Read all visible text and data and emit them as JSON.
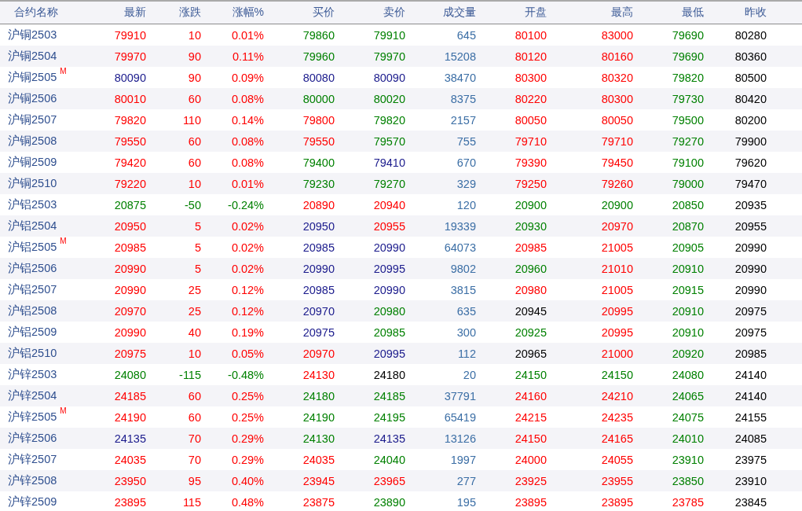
{
  "table": {
    "columns": [
      "合约名称",
      "最新",
      "涨跌",
      "涨幅%",
      "买价",
      "卖价",
      "成交量",
      "开盘",
      "最高",
      "最低",
      "昨收"
    ],
    "rows": [
      {
        "cells": [
          {
            "text": "沪铜2503"
          },
          {
            "text": "79910",
            "color": "#ff0000"
          },
          {
            "text": "10",
            "color": "#ff0000"
          },
          {
            "text": "0.01%",
            "color": "#ff0000"
          },
          {
            "text": "79860",
            "color": "#008000"
          },
          {
            "text": "79910",
            "color": "#008000"
          },
          {
            "text": "645",
            "color": "#3b6ea5"
          },
          {
            "text": "80100",
            "color": "#ff0000"
          },
          {
            "text": "83000",
            "color": "#ff0000"
          },
          {
            "text": "79690",
            "color": "#008000"
          },
          {
            "text": "80280",
            "color": "#000000"
          }
        ]
      },
      {
        "cells": [
          {
            "text": "沪铜2504"
          },
          {
            "text": "79970",
            "color": "#ff0000"
          },
          {
            "text": "90",
            "color": "#ff0000"
          },
          {
            "text": "0.11%",
            "color": "#ff0000"
          },
          {
            "text": "79960",
            "color": "#008000"
          },
          {
            "text": "79970",
            "color": "#008000"
          },
          {
            "text": "15208",
            "color": "#3b6ea5"
          },
          {
            "text": "80120",
            "color": "#ff0000"
          },
          {
            "text": "80160",
            "color": "#ff0000"
          },
          {
            "text": "79690",
            "color": "#008000"
          },
          {
            "text": "80360",
            "color": "#000000"
          }
        ]
      },
      {
        "cells": [
          {
            "text": "沪铜2505",
            "badge": "M"
          },
          {
            "text": "80090",
            "color": "#1a1a8c"
          },
          {
            "text": "90",
            "color": "#ff0000"
          },
          {
            "text": "0.09%",
            "color": "#ff0000"
          },
          {
            "text": "80080",
            "color": "#1a1a8c"
          },
          {
            "text": "80090",
            "color": "#1a1a8c"
          },
          {
            "text": "38470",
            "color": "#3b6ea5"
          },
          {
            "text": "80300",
            "color": "#ff0000"
          },
          {
            "text": "80320",
            "color": "#ff0000"
          },
          {
            "text": "79820",
            "color": "#008000"
          },
          {
            "text": "80500",
            "color": "#000000"
          }
        ]
      },
      {
        "cells": [
          {
            "text": "沪铜2506"
          },
          {
            "text": "80010",
            "color": "#ff0000"
          },
          {
            "text": "60",
            "color": "#ff0000"
          },
          {
            "text": "0.08%",
            "color": "#ff0000"
          },
          {
            "text": "80000",
            "color": "#008000"
          },
          {
            "text": "80020",
            "color": "#008000"
          },
          {
            "text": "8375",
            "color": "#3b6ea5"
          },
          {
            "text": "80220",
            "color": "#ff0000"
          },
          {
            "text": "80300",
            "color": "#ff0000"
          },
          {
            "text": "79730",
            "color": "#008000"
          },
          {
            "text": "80420",
            "color": "#000000"
          }
        ]
      },
      {
        "cells": [
          {
            "text": "沪铜2507"
          },
          {
            "text": "79820",
            "color": "#ff0000"
          },
          {
            "text": "110",
            "color": "#ff0000"
          },
          {
            "text": "0.14%",
            "color": "#ff0000"
          },
          {
            "text": "79800",
            "color": "#ff0000"
          },
          {
            "text": "79820",
            "color": "#008000"
          },
          {
            "text": "2157",
            "color": "#3b6ea5"
          },
          {
            "text": "80050",
            "color": "#ff0000"
          },
          {
            "text": "80050",
            "color": "#ff0000"
          },
          {
            "text": "79500",
            "color": "#008000"
          },
          {
            "text": "80200",
            "color": "#000000"
          }
        ]
      },
      {
        "cells": [
          {
            "text": "沪铜2508"
          },
          {
            "text": "79550",
            "color": "#ff0000"
          },
          {
            "text": "60",
            "color": "#ff0000"
          },
          {
            "text": "0.08%",
            "color": "#ff0000"
          },
          {
            "text": "79550",
            "color": "#ff0000"
          },
          {
            "text": "79570",
            "color": "#008000"
          },
          {
            "text": "755",
            "color": "#3b6ea5"
          },
          {
            "text": "79710",
            "color": "#ff0000"
          },
          {
            "text": "79710",
            "color": "#ff0000"
          },
          {
            "text": "79270",
            "color": "#008000"
          },
          {
            "text": "79900",
            "color": "#000000"
          }
        ]
      },
      {
        "cells": [
          {
            "text": "沪铜2509"
          },
          {
            "text": "79420",
            "color": "#ff0000"
          },
          {
            "text": "60",
            "color": "#ff0000"
          },
          {
            "text": "0.08%",
            "color": "#ff0000"
          },
          {
            "text": "79400",
            "color": "#008000"
          },
          {
            "text": "79410",
            "color": "#1a1a8c"
          },
          {
            "text": "670",
            "color": "#3b6ea5"
          },
          {
            "text": "79390",
            "color": "#ff0000"
          },
          {
            "text": "79450",
            "color": "#ff0000"
          },
          {
            "text": "79100",
            "color": "#008000"
          },
          {
            "text": "79620",
            "color": "#000000"
          }
        ]
      },
      {
        "cells": [
          {
            "text": "沪铜2510"
          },
          {
            "text": "79220",
            "color": "#ff0000"
          },
          {
            "text": "10",
            "color": "#ff0000"
          },
          {
            "text": "0.01%",
            "color": "#ff0000"
          },
          {
            "text": "79230",
            "color": "#008000"
          },
          {
            "text": "79270",
            "color": "#008000"
          },
          {
            "text": "329",
            "color": "#3b6ea5"
          },
          {
            "text": "79250",
            "color": "#ff0000"
          },
          {
            "text": "79260",
            "color": "#ff0000"
          },
          {
            "text": "79000",
            "color": "#008000"
          },
          {
            "text": "79470",
            "color": "#000000"
          }
        ]
      },
      {
        "cells": [
          {
            "text": "沪铝2503"
          },
          {
            "text": "20875",
            "color": "#008000"
          },
          {
            "text": "-50",
            "color": "#008000"
          },
          {
            "text": "-0.24%",
            "color": "#008000"
          },
          {
            "text": "20890",
            "color": "#ff0000"
          },
          {
            "text": "20940",
            "color": "#ff0000"
          },
          {
            "text": "120",
            "color": "#3b6ea5"
          },
          {
            "text": "20900",
            "color": "#008000"
          },
          {
            "text": "20900",
            "color": "#008000"
          },
          {
            "text": "20850",
            "color": "#008000"
          },
          {
            "text": "20935",
            "color": "#000000"
          }
        ]
      },
      {
        "cells": [
          {
            "text": "沪铝2504"
          },
          {
            "text": "20950",
            "color": "#ff0000"
          },
          {
            "text": "5",
            "color": "#ff0000"
          },
          {
            "text": "0.02%",
            "color": "#ff0000"
          },
          {
            "text": "20950",
            "color": "#1a1a8c"
          },
          {
            "text": "20955",
            "color": "#ff0000"
          },
          {
            "text": "19339",
            "color": "#3b6ea5"
          },
          {
            "text": "20930",
            "color": "#008000"
          },
          {
            "text": "20970",
            "color": "#ff0000"
          },
          {
            "text": "20870",
            "color": "#008000"
          },
          {
            "text": "20955",
            "color": "#000000"
          }
        ]
      },
      {
        "cells": [
          {
            "text": "沪铝2505",
            "badge": "M"
          },
          {
            "text": "20985",
            "color": "#ff0000"
          },
          {
            "text": "5",
            "color": "#ff0000"
          },
          {
            "text": "0.02%",
            "color": "#ff0000"
          },
          {
            "text": "20985",
            "color": "#1a1a8c"
          },
          {
            "text": "20990",
            "color": "#1a1a8c"
          },
          {
            "text": "64073",
            "color": "#3b6ea5"
          },
          {
            "text": "20985",
            "color": "#ff0000"
          },
          {
            "text": "21005",
            "color": "#ff0000"
          },
          {
            "text": "20905",
            "color": "#008000"
          },
          {
            "text": "20990",
            "color": "#000000"
          }
        ]
      },
      {
        "cells": [
          {
            "text": "沪铝2506"
          },
          {
            "text": "20990",
            "color": "#ff0000"
          },
          {
            "text": "5",
            "color": "#ff0000"
          },
          {
            "text": "0.02%",
            "color": "#ff0000"
          },
          {
            "text": "20990",
            "color": "#1a1a8c"
          },
          {
            "text": "20995",
            "color": "#1a1a8c"
          },
          {
            "text": "9802",
            "color": "#3b6ea5"
          },
          {
            "text": "20960",
            "color": "#008000"
          },
          {
            "text": "21010",
            "color": "#ff0000"
          },
          {
            "text": "20910",
            "color": "#008000"
          },
          {
            "text": "20990",
            "color": "#000000"
          }
        ]
      },
      {
        "cells": [
          {
            "text": "沪铝2507"
          },
          {
            "text": "20990",
            "color": "#ff0000"
          },
          {
            "text": "25",
            "color": "#ff0000"
          },
          {
            "text": "0.12%",
            "color": "#ff0000"
          },
          {
            "text": "20985",
            "color": "#1a1a8c"
          },
          {
            "text": "20990",
            "color": "#1a1a8c"
          },
          {
            "text": "3815",
            "color": "#3b6ea5"
          },
          {
            "text": "20980",
            "color": "#ff0000"
          },
          {
            "text": "21005",
            "color": "#ff0000"
          },
          {
            "text": "20915",
            "color": "#008000"
          },
          {
            "text": "20990",
            "color": "#000000"
          }
        ]
      },
      {
        "cells": [
          {
            "text": "沪铝2508"
          },
          {
            "text": "20970",
            "color": "#ff0000"
          },
          {
            "text": "25",
            "color": "#ff0000"
          },
          {
            "text": "0.12%",
            "color": "#ff0000"
          },
          {
            "text": "20970",
            "color": "#1a1a8c"
          },
          {
            "text": "20980",
            "color": "#008000"
          },
          {
            "text": "635",
            "color": "#3b6ea5"
          },
          {
            "text": "20945",
            "color": "#000000"
          },
          {
            "text": "20995",
            "color": "#ff0000"
          },
          {
            "text": "20910",
            "color": "#008000"
          },
          {
            "text": "20975",
            "color": "#000000"
          }
        ]
      },
      {
        "cells": [
          {
            "text": "沪铝2509"
          },
          {
            "text": "20990",
            "color": "#ff0000"
          },
          {
            "text": "40",
            "color": "#ff0000"
          },
          {
            "text": "0.19%",
            "color": "#ff0000"
          },
          {
            "text": "20975",
            "color": "#1a1a8c"
          },
          {
            "text": "20985",
            "color": "#008000"
          },
          {
            "text": "300",
            "color": "#3b6ea5"
          },
          {
            "text": "20925",
            "color": "#008000"
          },
          {
            "text": "20995",
            "color": "#ff0000"
          },
          {
            "text": "20910",
            "color": "#008000"
          },
          {
            "text": "20975",
            "color": "#000000"
          }
        ]
      },
      {
        "cells": [
          {
            "text": "沪铝2510"
          },
          {
            "text": "20975",
            "color": "#ff0000"
          },
          {
            "text": "10",
            "color": "#ff0000"
          },
          {
            "text": "0.05%",
            "color": "#ff0000"
          },
          {
            "text": "20970",
            "color": "#ff0000"
          },
          {
            "text": "20995",
            "color": "#1a1a8c"
          },
          {
            "text": "112",
            "color": "#3b6ea5"
          },
          {
            "text": "20965",
            "color": "#000000"
          },
          {
            "text": "21000",
            "color": "#ff0000"
          },
          {
            "text": "20920",
            "color": "#008000"
          },
          {
            "text": "20985",
            "color": "#000000"
          }
        ]
      },
      {
        "cells": [
          {
            "text": "沪锌2503"
          },
          {
            "text": "24080",
            "color": "#008000"
          },
          {
            "text": "-115",
            "color": "#008000"
          },
          {
            "text": "-0.48%",
            "color": "#008000"
          },
          {
            "text": "24130",
            "color": "#ff0000"
          },
          {
            "text": "24180",
            "color": "#000000"
          },
          {
            "text": "20",
            "color": "#3b6ea5"
          },
          {
            "text": "24150",
            "color": "#008000"
          },
          {
            "text": "24150",
            "color": "#008000"
          },
          {
            "text": "24080",
            "color": "#008000"
          },
          {
            "text": "24140",
            "color": "#000000"
          }
        ]
      },
      {
        "cells": [
          {
            "text": "沪锌2504"
          },
          {
            "text": "24185",
            "color": "#ff0000"
          },
          {
            "text": "60",
            "color": "#ff0000"
          },
          {
            "text": "0.25%",
            "color": "#ff0000"
          },
          {
            "text": "24180",
            "color": "#008000"
          },
          {
            "text": "24185",
            "color": "#008000"
          },
          {
            "text": "37791",
            "color": "#3b6ea5"
          },
          {
            "text": "24160",
            "color": "#ff0000"
          },
          {
            "text": "24210",
            "color": "#ff0000"
          },
          {
            "text": "24065",
            "color": "#008000"
          },
          {
            "text": "24140",
            "color": "#000000"
          }
        ]
      },
      {
        "cells": [
          {
            "text": "沪锌2505",
            "badge": "M"
          },
          {
            "text": "24190",
            "color": "#ff0000"
          },
          {
            "text": "60",
            "color": "#ff0000"
          },
          {
            "text": "0.25%",
            "color": "#ff0000"
          },
          {
            "text": "24190",
            "color": "#008000"
          },
          {
            "text": "24195",
            "color": "#008000"
          },
          {
            "text": "65419",
            "color": "#3b6ea5"
          },
          {
            "text": "24215",
            "color": "#ff0000"
          },
          {
            "text": "24235",
            "color": "#ff0000"
          },
          {
            "text": "24075",
            "color": "#008000"
          },
          {
            "text": "24155",
            "color": "#000000"
          }
        ]
      },
      {
        "cells": [
          {
            "text": "沪锌2506"
          },
          {
            "text": "24135",
            "color": "#1a1a8c"
          },
          {
            "text": "70",
            "color": "#ff0000"
          },
          {
            "text": "0.29%",
            "color": "#ff0000"
          },
          {
            "text": "24130",
            "color": "#008000"
          },
          {
            "text": "24135",
            "color": "#1a1a8c"
          },
          {
            "text": "13126",
            "color": "#3b6ea5"
          },
          {
            "text": "24150",
            "color": "#ff0000"
          },
          {
            "text": "24165",
            "color": "#ff0000"
          },
          {
            "text": "24010",
            "color": "#008000"
          },
          {
            "text": "24085",
            "color": "#000000"
          }
        ]
      },
      {
        "cells": [
          {
            "text": "沪锌2507"
          },
          {
            "text": "24035",
            "color": "#ff0000"
          },
          {
            "text": "70",
            "color": "#ff0000"
          },
          {
            "text": "0.29%",
            "color": "#ff0000"
          },
          {
            "text": "24035",
            "color": "#ff0000"
          },
          {
            "text": "24040",
            "color": "#008000"
          },
          {
            "text": "1997",
            "color": "#3b6ea5"
          },
          {
            "text": "24000",
            "color": "#ff0000"
          },
          {
            "text": "24055",
            "color": "#ff0000"
          },
          {
            "text": "23910",
            "color": "#008000"
          },
          {
            "text": "23975",
            "color": "#000000"
          }
        ]
      },
      {
        "cells": [
          {
            "text": "沪锌2508"
          },
          {
            "text": "23950",
            "color": "#ff0000"
          },
          {
            "text": "95",
            "color": "#ff0000"
          },
          {
            "text": "0.40%",
            "color": "#ff0000"
          },
          {
            "text": "23945",
            "color": "#ff0000"
          },
          {
            "text": "23965",
            "color": "#ff0000"
          },
          {
            "text": "277",
            "color": "#3b6ea5"
          },
          {
            "text": "23925",
            "color": "#ff0000"
          },
          {
            "text": "23955",
            "color": "#ff0000"
          },
          {
            "text": "23850",
            "color": "#008000"
          },
          {
            "text": "23910",
            "color": "#000000"
          }
        ]
      },
      {
        "cells": [
          {
            "text": "沪锌2509"
          },
          {
            "text": "23895",
            "color": "#ff0000"
          },
          {
            "text": "115",
            "color": "#ff0000"
          },
          {
            "text": "0.48%",
            "color": "#ff0000"
          },
          {
            "text": "23875",
            "color": "#ff0000"
          },
          {
            "text": "23890",
            "color": "#008000"
          },
          {
            "text": "195",
            "color": "#3b6ea5"
          },
          {
            "text": "23895",
            "color": "#ff0000"
          },
          {
            "text": "23895",
            "color": "#ff0000"
          },
          {
            "text": "23785",
            "color": "#ff0000"
          },
          {
            "text": "23845",
            "color": "#000000"
          }
        ]
      }
    ]
  }
}
